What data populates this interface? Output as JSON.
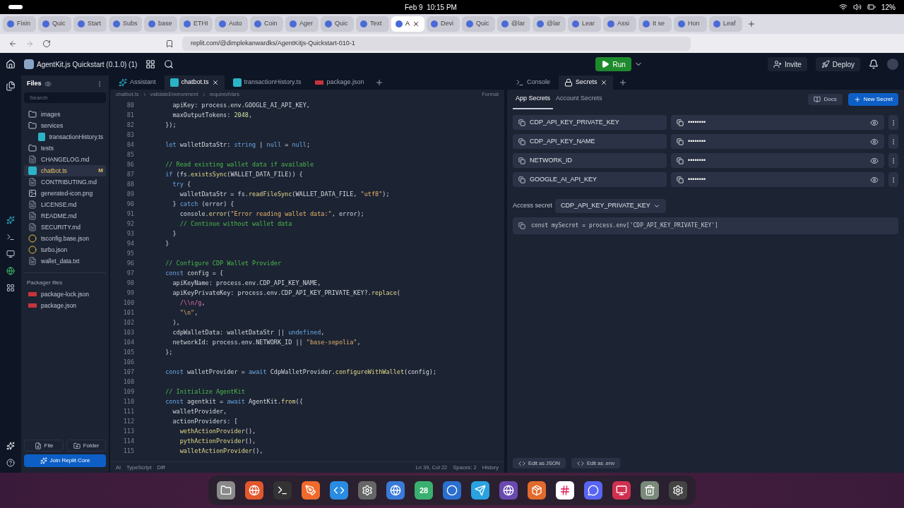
{
  "system_bar": {
    "datetime": "Feb 9  10:15 PM",
    "battery": "12%"
  },
  "browser": {
    "tabs": [
      {
        "label": "Fixin",
        "selected": false
      },
      {
        "label": "Quic",
        "selected": false
      },
      {
        "label": "Start",
        "selected": false
      },
      {
        "label": "Subs",
        "selected": false
      },
      {
        "label": "base",
        "selected": false
      },
      {
        "label": "ETHI",
        "selected": false
      },
      {
        "label": "Auto",
        "selected": false
      },
      {
        "label": "Coin",
        "selected": false
      },
      {
        "label": "Ager",
        "selected": false
      },
      {
        "label": "Quic",
        "selected": false
      },
      {
        "label": "Text",
        "selected": false
      },
      {
        "label": "A",
        "selected": true
      },
      {
        "label": "Devi",
        "selected": false
      },
      {
        "label": "Quic",
        "selected": false
      },
      {
        "label": "@lar",
        "selected": false
      },
      {
        "label": "@lar",
        "selected": false
      },
      {
        "label": "Lear",
        "selected": false
      },
      {
        "label": "Assi",
        "selected": false
      },
      {
        "label": "It se",
        "selected": false
      },
      {
        "label": "Hon",
        "selected": false
      },
      {
        "label": "Leaf",
        "selected": false
      }
    ],
    "url": "replit.com/@dimplekanwardks/AgentKitjs-Quickstart-010-1"
  },
  "header": {
    "project": "AgentKit.js Quickstart (0.1.0) (1)",
    "run": "Run",
    "invite": "Invite",
    "deploy": "Deploy"
  },
  "files": {
    "title": "Files",
    "search_placeholder": "Search",
    "tree": [
      {
        "name": "images",
        "kind": "folder",
        "selected": false
      },
      {
        "name": "services",
        "kind": "folder",
        "selected": false,
        "children": [
          {
            "name": "transactionHistory.ts",
            "kind": "ts",
            "selected": false
          }
        ]
      },
      {
        "name": "tests",
        "kind": "folder",
        "selected": false
      },
      {
        "name": "CHANGELOG.md",
        "kind": "md",
        "selected": false
      },
      {
        "name": "chatbot.ts",
        "kind": "ts",
        "selected": true,
        "badge": "M"
      },
      {
        "name": "CONTRIBUTING.md",
        "kind": "md",
        "selected": false
      },
      {
        "name": "generated-icon.png",
        "kind": "png",
        "selected": false
      },
      {
        "name": "LICENSE.md",
        "kind": "md",
        "selected": false
      },
      {
        "name": "README.md",
        "kind": "md",
        "selected": false
      },
      {
        "name": "SECURITY.md",
        "kind": "md",
        "selected": false
      },
      {
        "name": "tsconfig.base.json",
        "kind": "json",
        "selected": false
      },
      {
        "name": "turbo.json",
        "kind": "json",
        "selected": false
      },
      {
        "name": "wallet_data.txt",
        "kind": "txt",
        "selected": false
      }
    ],
    "packager_title": "Packager files",
    "packager": [
      {
        "name": "package-lock.json",
        "kind": "npm",
        "selected": false
      },
      {
        "name": "package.json",
        "kind": "npm",
        "selected": false
      }
    ],
    "buttons": [
      "File",
      "Folder"
    ],
    "core_button": "Join Replit Core"
  },
  "editor": {
    "tabs": [
      {
        "label": "Assistant",
        "kind": "assistant",
        "selected": false
      },
      {
        "label": "chatbot.ts",
        "kind": "ts",
        "selected": true
      },
      {
        "label": "transactionHistory.ts",
        "kind": "ts",
        "selected": false
      },
      {
        "label": "package.json",
        "kind": "npm",
        "selected": false
      }
    ],
    "breadcrumb": [
      "chatbot.ts",
      "validateEnvironment",
      "requiredVars"
    ],
    "format": "Format",
    "lines": [
      {
        "n": "80",
        "t": [
          {
            "kind": "pl",
            "text": "    apiKey: process.env.GOOGLE_AI_API_KEY,"
          }
        ]
      },
      {
        "n": "81",
        "t": [
          {
            "kind": "pl",
            "text": "    maxOutputTokens: "
          },
          {
            "kind": "num",
            "text": "2048"
          },
          {
            "kind": "pl",
            "text": ","
          }
        ]
      },
      {
        "n": "82",
        "t": [
          {
            "kind": "pl",
            "text": "  });"
          }
        ]
      },
      {
        "n": "83"
      },
      {
        "n": "84",
        "t": [
          {
            "kind": "kw",
            "text": "  let"
          },
          {
            "kind": "pl",
            "text": " walletDataStr: "
          },
          {
            "kind": "kw",
            "text": "string"
          },
          {
            "kind": "pl",
            "text": " | "
          },
          {
            "kind": "kw",
            "text": "null"
          },
          {
            "kind": "pl",
            "text": " = "
          },
          {
            "kind": "kw",
            "text": "null"
          },
          {
            "kind": "pl",
            "text": ";"
          }
        ]
      },
      {
        "n": "85"
      },
      {
        "n": "86",
        "t": [
          {
            "kind": "cm",
            "text": "  // Read existing wallet data if available"
          }
        ]
      },
      {
        "n": "87",
        "t": [
          {
            "kind": "kw",
            "text": "  if"
          },
          {
            "kind": "pl",
            "text": " (fs."
          },
          {
            "kind": "fn",
            "text": "existsSync"
          },
          {
            "kind": "pl",
            "text": "(WALLET_DATA_FILE)) {"
          }
        ]
      },
      {
        "n": "88",
        "t": [
          {
            "kind": "kw",
            "text": "    try"
          },
          {
            "kind": "pl",
            "text": " {"
          }
        ]
      },
      {
        "n": "89",
        "t": [
          {
            "kind": "pl",
            "text": "      walletDataStr = fs."
          },
          {
            "kind": "fn",
            "text": "readFileSync"
          },
          {
            "kind": "pl",
            "text": "(WALLET_DATA_FILE, "
          },
          {
            "kind": "str",
            "text": "\"utf8\""
          },
          {
            "kind": "pl",
            "text": ");"
          }
        ]
      },
      {
        "n": "90",
        "t": [
          {
            "kind": "pl",
            "text": "    } "
          },
          {
            "kind": "kw",
            "text": "catch"
          },
          {
            "kind": "pl",
            "text": " (error) {"
          }
        ]
      },
      {
        "n": "91",
        "t": [
          {
            "kind": "pl",
            "text": "      console."
          },
          {
            "kind": "fn",
            "text": "error"
          },
          {
            "kind": "pl",
            "text": "("
          },
          {
            "kind": "str",
            "text": "\"Error reading wallet data:\""
          },
          {
            "kind": "pl",
            "text": ", error);"
          }
        ]
      },
      {
        "n": "92",
        "t": [
          {
            "kind": "cm",
            "text": "      // Continue without wallet data"
          }
        ]
      },
      {
        "n": "93",
        "t": [
          {
            "kind": "pl",
            "text": "    }"
          }
        ]
      },
      {
        "n": "94",
        "t": [
          {
            "kind": "pl",
            "text": "  }"
          }
        ]
      },
      {
        "n": "95"
      },
      {
        "n": "96",
        "t": [
          {
            "kind": "cm",
            "text": "  // Configure CDP Wallet Provider"
          }
        ]
      },
      {
        "n": "97",
        "t": [
          {
            "kind": "kw",
            "text": "  const"
          },
          {
            "kind": "pl",
            "text": " config = {"
          }
        ]
      },
      {
        "n": "98",
        "t": [
          {
            "kind": "pl",
            "text": "    apiKeyName: process.env.CDP_API_KEY_NAME,"
          }
        ]
      },
      {
        "n": "99",
        "t": [
          {
            "kind": "pl",
            "text": "    apiKeyPrivateKey: process.env.CDP_API_KEY_PRIVATE_KEY?."
          },
          {
            "kind": "fn",
            "text": "replace"
          },
          {
            "kind": "pl",
            "text": "("
          }
        ]
      },
      {
        "n": "100",
        "t": [
          {
            "kind": "re",
            "text": "      /\\\\n/g"
          },
          {
            "kind": "pl",
            "text": ","
          }
        ]
      },
      {
        "n": "101",
        "t": [
          {
            "kind": "str",
            "text": "      \"\\n\""
          },
          {
            "kind": "pl",
            "text": ","
          }
        ]
      },
      {
        "n": "102",
        "t": [
          {
            "kind": "pl",
            "text": "    ),"
          }
        ]
      },
      {
        "n": "103",
        "t": [
          {
            "kind": "pl",
            "text": "    cdpWalletData: walletDataStr || "
          },
          {
            "kind": "kw",
            "text": "undefined"
          },
          {
            "kind": "pl",
            "text": ","
          }
        ]
      },
      {
        "n": "104",
        "t": [
          {
            "kind": "pl",
            "text": "    networkId: process.env.NETWORK_ID || "
          },
          {
            "kind": "str",
            "text": "\"base-sepolia\""
          },
          {
            "kind": "pl",
            "text": ","
          }
        ]
      },
      {
        "n": "105",
        "t": [
          {
            "kind": "pl",
            "text": "  };"
          }
        ]
      },
      {
        "n": "106"
      },
      {
        "n": "107",
        "t": [
          {
            "kind": "kw",
            "text": "  const"
          },
          {
            "kind": "pl",
            "text": " walletProvider = "
          },
          {
            "kind": "kw",
            "text": "await"
          },
          {
            "kind": "pl",
            "text": " CdpWalletProvider."
          },
          {
            "kind": "fn",
            "text": "configureWithWallet"
          },
          {
            "kind": "pl",
            "text": "(config);"
          }
        ]
      },
      {
        "n": "108"
      },
      {
        "n": "109",
        "t": [
          {
            "kind": "cm",
            "text": "  // Initialize AgentKit"
          }
        ]
      },
      {
        "n": "110",
        "t": [
          {
            "kind": "kw",
            "text": "  const"
          },
          {
            "kind": "pl",
            "text": " agentkit = "
          },
          {
            "kind": "kw",
            "text": "await"
          },
          {
            "kind": "pl",
            "text": " AgentKit."
          },
          {
            "kind": "fn",
            "text": "from"
          },
          {
            "kind": "pl",
            "text": "({"
          }
        ]
      },
      {
        "n": "111",
        "t": [
          {
            "kind": "pl",
            "text": "    walletProvider,"
          }
        ]
      },
      {
        "n": "112",
        "t": [
          {
            "kind": "pl",
            "text": "    actionProviders: ["
          }
        ]
      },
      {
        "n": "113",
        "t": [
          {
            "kind": "fn",
            "text": "      wethActionProvider"
          },
          {
            "kind": "pl",
            "text": "(),"
          }
        ]
      },
      {
        "n": "114",
        "t": [
          {
            "kind": "fn",
            "text": "      pythActionProvider"
          },
          {
            "kind": "pl",
            "text": "(),"
          }
        ]
      },
      {
        "n": "115",
        "t": [
          {
            "kind": "fn",
            "text": "      walletActionProvider"
          },
          {
            "kind": "pl",
            "text": "(),"
          }
        ]
      }
    ],
    "status": {
      "ai": "AI",
      "language": "TypeScript",
      "diff": "Diff",
      "position": "Ln 39, Col 22",
      "spaces": "Spaces: 2",
      "history": "History"
    }
  },
  "panel": {
    "tabs": [
      {
        "label": "Console",
        "kind": "console",
        "selected": false
      },
      {
        "label": "Secrets",
        "kind": "secrets",
        "selected": true
      }
    ],
    "subtabs": [
      {
        "label": "App Secrets",
        "selected": true
      },
      {
        "label": "Account Secrets",
        "selected": false
      }
    ],
    "docs": "Docs",
    "new_secret": "New Secret",
    "secrets": [
      {
        "key": "CDP_API_KEY_PRIVATE_KEY",
        "value": "••••••••"
      },
      {
        "key": "CDP_API_KEY_NAME",
        "value": "••••••••"
      },
      {
        "key": "NETWORK_ID",
        "value": "••••••••"
      },
      {
        "key": "GOOGLE_AI_API_KEY",
        "value": "••••••••"
      }
    ],
    "access_label": "Access secret",
    "access_value": "CDP_API_KEY_PRIVATE_KEY",
    "snippet": "const mySecret = process.env['CDP_API_KEY_PRIVATE_KEY']",
    "footer": [
      "Edit as JSON",
      "Edit as .env"
    ]
  },
  "dock": {
    "calendar_day": "28"
  }
}
